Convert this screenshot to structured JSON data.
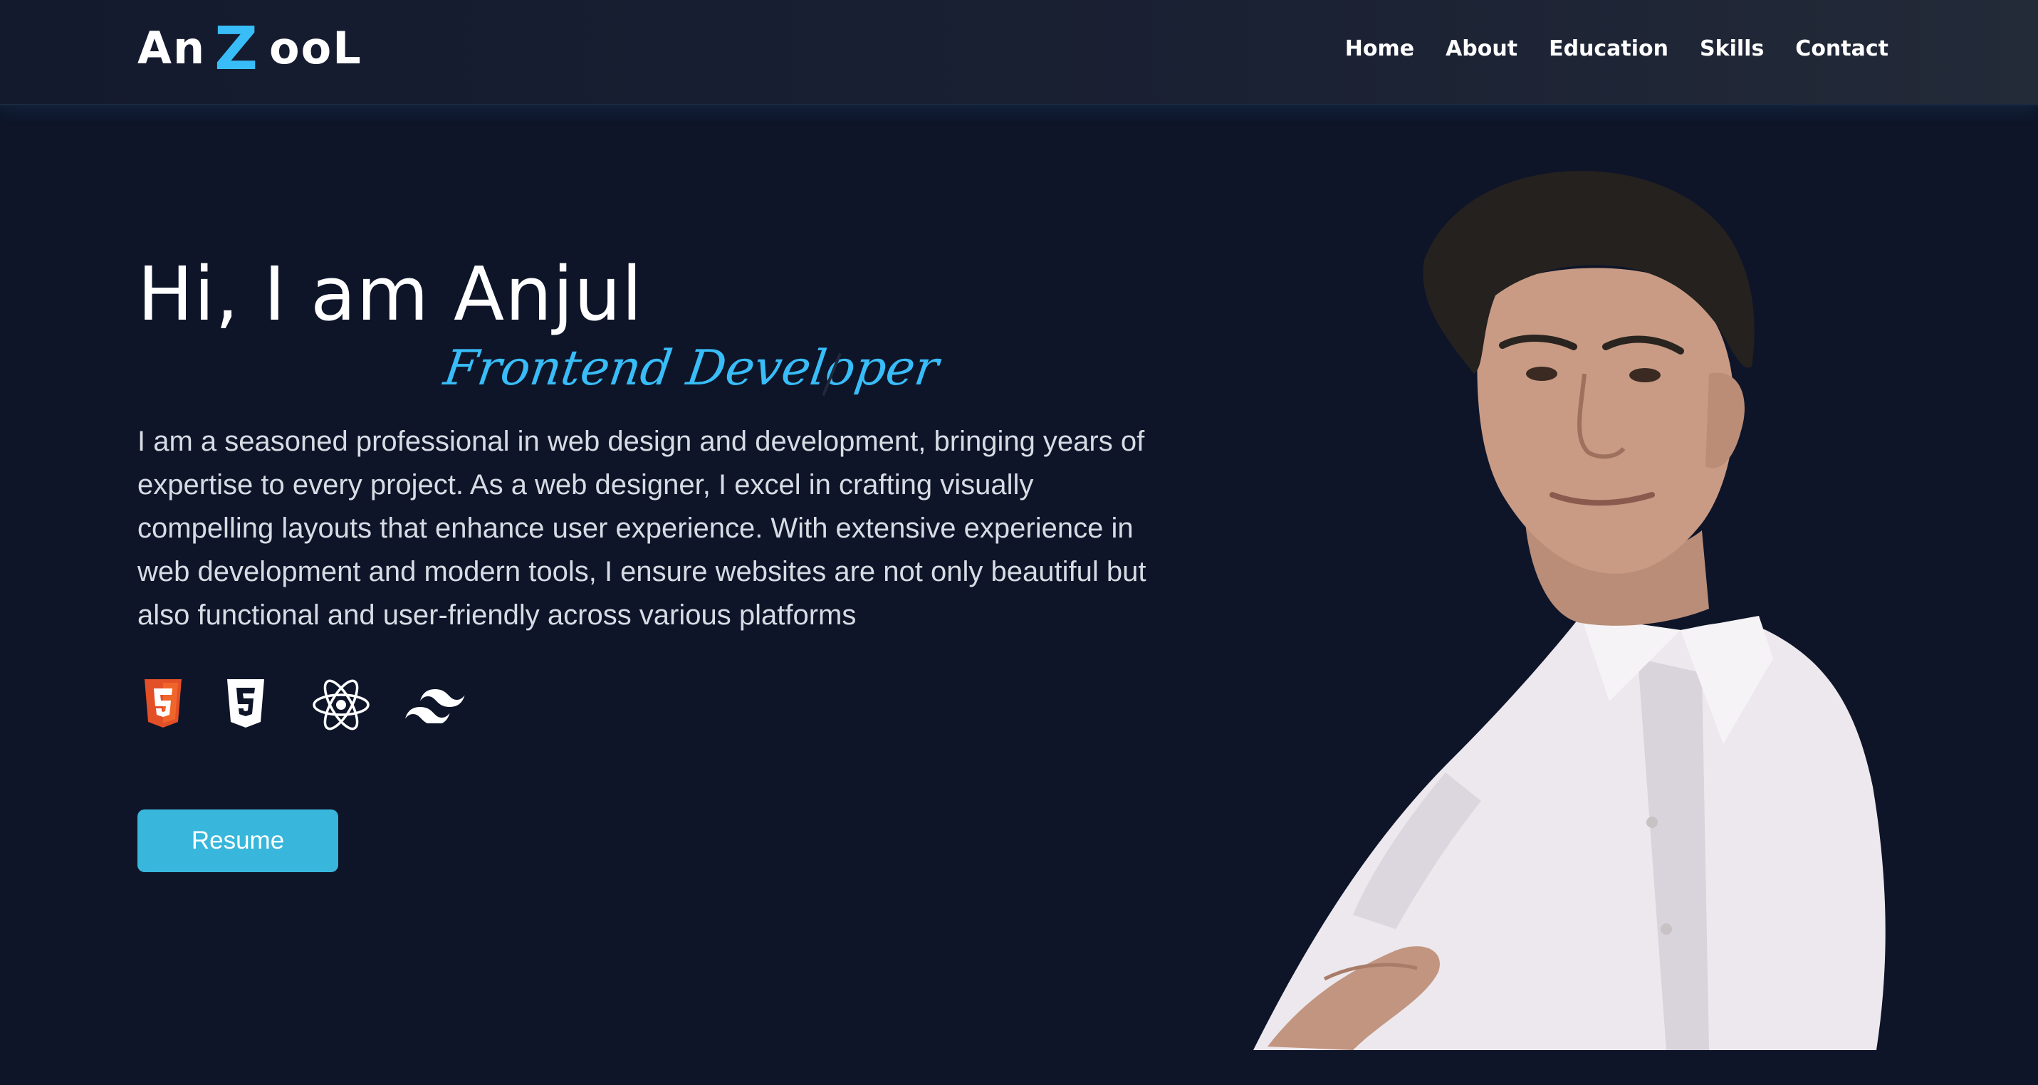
{
  "header": {
    "logo": {
      "part1": "An",
      "accent": "Z",
      "part2": "ooL"
    },
    "nav": [
      {
        "label": "Home"
      },
      {
        "label": "About"
      },
      {
        "label": "Education"
      },
      {
        "label": "Skills"
      },
      {
        "label": "Contact"
      }
    ]
  },
  "hero": {
    "greeting": "Hi, I am Anjul",
    "role": "Frontend Developer",
    "bio": "I am a seasoned professional in web design and development, bringing years of expertise to every project. As a web designer, I excel in crafting visually compelling layouts that enhance user experience. With extensive experience in web development and modern tools, I ensure websites are not only beautiful but also functional and user-friendly across various platforms",
    "tech_icons": [
      "html5-icon",
      "css3-icon",
      "react-icon",
      "tailwind-icon"
    ],
    "resume_label": "Resume"
  },
  "colors": {
    "background": "#0e1529",
    "accent": "#38bdf8",
    "button": "#38b6db",
    "html5": "#e34f26",
    "text": "#ffffff"
  }
}
